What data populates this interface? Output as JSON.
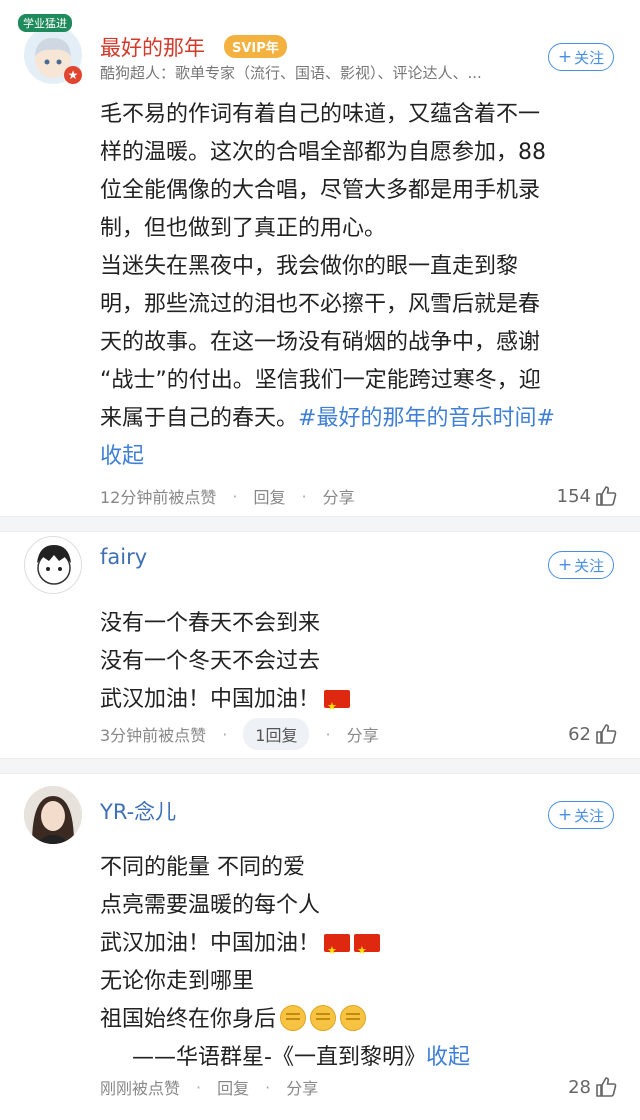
{
  "comments": [
    {
      "name": "最好的那年",
      "badge": "SVIP年",
      "avatar_badge": "学业猛进",
      "subtitle": "酷狗超人：歌单专家（流行、国语、影视）、评论达人、...",
      "follow_label": "关注",
      "body_lines": [
        "毛不易的作词有着自己的味道，又蕴含着不一",
        "样的温暖。这次的合唱全部都为自愿参加，88",
        "位全能偶像的大合唱，尽管大多都是用手机录",
        "制，但也做到了真正的用心。",
        "当迷失在黑夜中，我会做你的眼一直走到黎",
        "明，那些流过的泪也不必擦干，风雪后就是春",
        "天的故事。在这一场没有硝烟的战争中，感谢",
        "“战士”的付出。坚信我们一定能跨过寒冬，迎"
      ],
      "last_line_text": "来属于自己的春天。",
      "hashtag": "#最好的那年的音乐时间#",
      "collapse": "收起",
      "time": "12分钟前被点赞",
      "reply": "回复",
      "share": "分享",
      "likes": "154"
    },
    {
      "name": "fairy",
      "follow_label": "关注",
      "body_lines": [
        "没有一个春天不会到来",
        "没有一个冬天不会过去"
      ],
      "last_line_text": "武汉加油！中国加油！",
      "time": "3分钟前被点赞",
      "reply": "1回复",
      "share": "分享",
      "likes": "62"
    },
    {
      "name": "YR-念儿",
      "follow_label": "关注",
      "body_lines": [
        "不同的能量 不同的爱",
        "点亮需要温暖的每个人"
      ],
      "flag_line": "武汉加油！中国加油！",
      "line4": "无论你走到哪里",
      "line5": "祖国始终在你身后",
      "quote": "——华语群星-《一直到黎明》",
      "collapse": "收起",
      "time": "刚刚被点赞",
      "reply": "回复",
      "share": "分享",
      "likes": "28"
    }
  ],
  "colors": {
    "name_red": "#d23a2a",
    "name_blue": "#3f6fb5",
    "link": "#3f7fd6",
    "svip": "#f3b13f"
  }
}
